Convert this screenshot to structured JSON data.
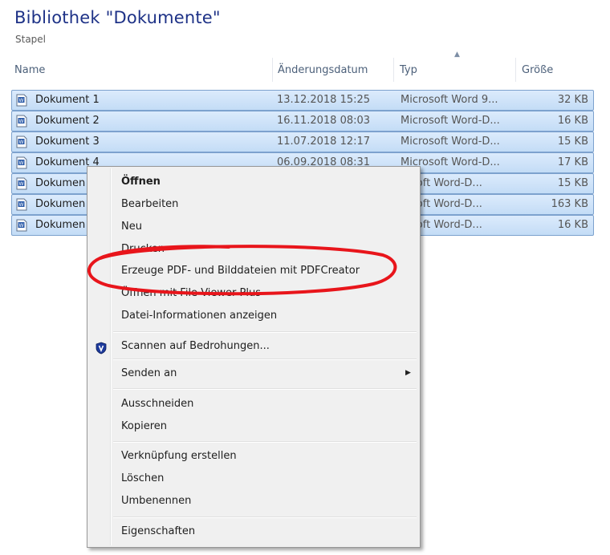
{
  "library": {
    "title": "Bibliothek \"Dokumente\"",
    "subtitle": "Stapel"
  },
  "columns": {
    "name": "Name",
    "date": "Änderungsdatum",
    "type": "Typ",
    "size": "Größe"
  },
  "files": [
    {
      "name": "Dokument 1",
      "date": "13.12.2018 15:25",
      "type": "Microsoft Word 9...",
      "size": "32 KB"
    },
    {
      "name": "Dokument 2",
      "date": "16.11.2018 08:03",
      "type": "Microsoft Word-D...",
      "size": "16 KB"
    },
    {
      "name": "Dokument 3",
      "date": "11.07.2018 12:17",
      "type": "Microsoft Word-D...",
      "size": "15 KB"
    },
    {
      "name": "Dokument 4",
      "date": "06.09.2018 08:31",
      "type": "Microsoft Word-D...",
      "size": "17 KB"
    },
    {
      "name": "Dokumen",
      "date": "",
      "type": "rosoft Word-D...",
      "size": "15 KB"
    },
    {
      "name": "Dokumen",
      "date": "",
      "type": "rosoft Word-D...",
      "size": "163 KB"
    },
    {
      "name": "Dokumen",
      "date": "",
      "type": "rosoft Word-D...",
      "size": "16 KB"
    }
  ],
  "context_menu": {
    "open": "Öffnen",
    "edit": "Bearbeiten",
    "new": "Neu",
    "print": "Drucken",
    "pdfcreator": "Erzeuge PDF- und Bilddateien mit PDFCreator",
    "open_with": "Öffnen mit File Viewer Plus",
    "file_info": "Datei-Informationen anzeigen",
    "scan": "Scannen auf Bedrohungen...",
    "send_to": "Senden an",
    "cut": "Ausschneiden",
    "copy": "Kopieren",
    "create_shortcut": "Verknüpfung erstellen",
    "delete": "Löschen",
    "rename": "Umbenennen",
    "properties": "Eigenschaften"
  },
  "icons": {
    "file": "word-document-icon",
    "scan": "shield-icon",
    "submenu": "triangle-right-icon"
  },
  "colors": {
    "title": "#1e3287",
    "selection": "#c3dcf6",
    "highlight_ellipse": "#e8151b"
  }
}
